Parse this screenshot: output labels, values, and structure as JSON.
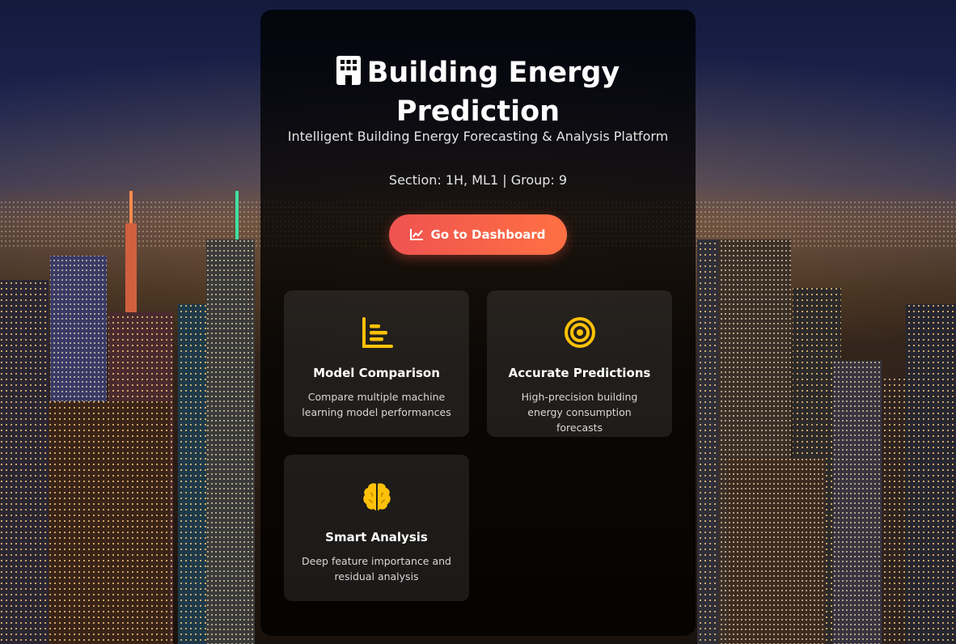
{
  "hero": {
    "title": "Building Energy Prediction",
    "subtitle": "Intelligent Building Energy Forecasting & Analysis Platform",
    "section_info": "Section: 1H, ML1 | Group: 9",
    "icon": "building-icon"
  },
  "cta": {
    "label": "Go to Dashboard",
    "icon": "chart-line-icon"
  },
  "features": [
    {
      "icon": "bar-chart-icon",
      "title": "Model Comparison",
      "description": "Compare multiple machine learning model performances"
    },
    {
      "icon": "target-icon",
      "title": "Accurate Predictions",
      "description": "High-precision building energy consumption forecasts"
    },
    {
      "icon": "brain-icon",
      "title": "Smart Analysis",
      "description": "Deep feature importance and residual analysis"
    }
  ],
  "colors": {
    "accent_start": "#ef5350",
    "accent_end": "#ff7043",
    "icon_yellow": "#ffc107"
  }
}
